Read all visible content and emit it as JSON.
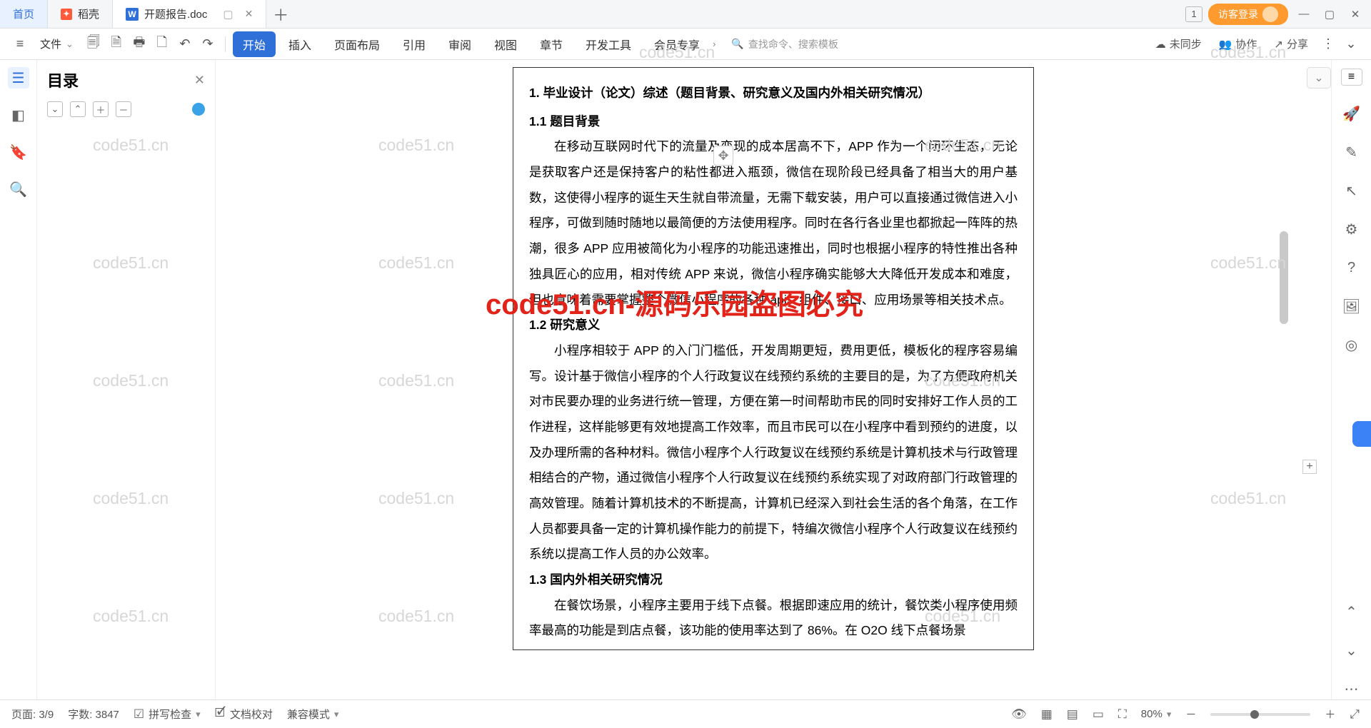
{
  "titlebar": {
    "home": "首页",
    "tab_docer": "稻壳",
    "tab_doc": "开题报告.doc",
    "badge": "1",
    "login": "访客登录"
  },
  "ribbon": {
    "file": "文件",
    "tabs": [
      "开始",
      "插入",
      "页面布局",
      "引用",
      "审阅",
      "视图",
      "章节",
      "开发工具",
      "会员专享"
    ],
    "search_placeholder": "查找命令、搜索模板",
    "sync": "未同步",
    "collab": "协作",
    "share": "分享"
  },
  "sidepanel": {
    "title": "目录"
  },
  "document": {
    "h1": "1. 毕业设计（论文）综述（题目背景、研究意义及国内外相关研究情况）",
    "s11": "1.1  题目背景",
    "p1a": "在移动互联网时代下的流量及变现的成本居高不下，APP 作为一个闭环生态，无论是获取客户还是保持客户的粘性都进入瓶颈，微信在现阶段已经具备了相当大的用户基数，这使得小程序的诞生天生就自带流量，无需下载安装，用户可以直接通过微信进入小程序，可做到随时随地以最简便的方法使用程序。同时在各行各业里也都掀起一阵阵的热潮，很多 APP 应用被简化为小程序的功能迅速推出，同时也根据小程序的特性推出各种独具匠心的应用，相对传统 APP 来说，微信小程序确实能够大大降低开发成本和难度，但也意味着需要掌握整个微信小程序的各种 ",
    "p1b": "、组件、接口、应用场景等相关技术点。",
    "api": "api",
    "s12": "1.2  研究意义",
    "p2": "小程序相较于 APP 的入门门槛低，开发周期更短，费用更低，模板化的程序容易编写。设计基于微信小程序的个人行政复议在线预约系统的主要目的是，为了方便政府机关对市民要办理的业务进行统一管理，方便在第一时间帮助市民的同时安排好工作人员的工作进程，这样能够更有效地提高工作效率，而且市民可以在小程序中看到预约的进度，以及办理所需的各种材料。微信小程序个人行政复议在线预约系统是计算机技术与行政管理相结合的产物，通过微信小程序个人行政复议在线预约系统实现了对政府部门行政管理的高效管理。随着计算机技术的不断提高，计算机已经深入到社会生活的各个角落，在工作人员都要具备一定的计算机操作能力的前提下，特编次微信小程序个人行政复议在线预约系统以提高工作人员的办公效率。",
    "s13": "1.3  国内外相关研究情况",
    "p3": "在餐饮场景，小程序主要用于线下点餐。根据即速应用的统计，餐饮类小程序使用频率最高的功能是到店点餐，该功能的使用率达到了 86%。在 O2O 线下点餐场景"
  },
  "watermark": {
    "red": "code51.cn-源码乐园盗图必究",
    "gray": "code51.cn"
  },
  "status": {
    "page": "页面: 3/9",
    "words": "字数: 3847",
    "spell": "拼写检查",
    "proof": "文档校对",
    "compat": "兼容模式",
    "zoom": "80%"
  }
}
